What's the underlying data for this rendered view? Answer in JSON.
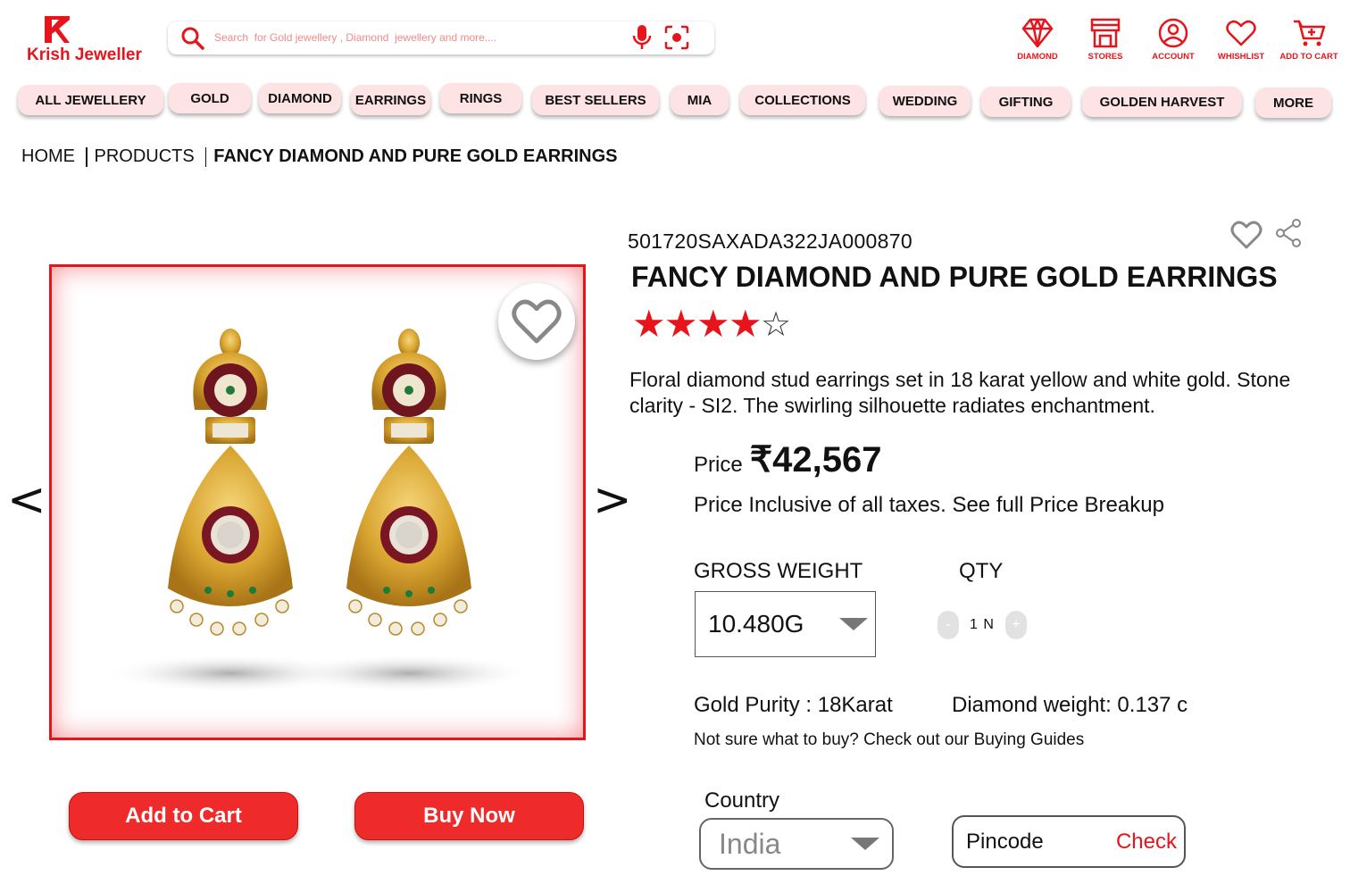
{
  "brand": {
    "name": "Krish Jeweller",
    "accent": "#e8141b"
  },
  "search": {
    "placeholder": "Search  for Gold jewellery , Diamond  jewellery and more...."
  },
  "header_icons": [
    {
      "icon": "diamond-icon",
      "label": "DIAMOND"
    },
    {
      "icon": "store-icon",
      "label": "STORES"
    },
    {
      "icon": "account-icon",
      "label": "ACCOUNT"
    },
    {
      "icon": "heart-icon",
      "label": "WHISHLIST"
    },
    {
      "icon": "cart-add-icon",
      "label": "ADD TO CART"
    }
  ],
  "nav": [
    "ALL JEWELLERY",
    "GOLD",
    "DIAMOND",
    "EARRINGS",
    "RINGS",
    "BEST SELLERS",
    "MIA",
    "COLLECTIONS",
    "WEDDING",
    "GIFTING",
    "GOLDEN HARVEST",
    "MORE"
  ],
  "breadcrumb": [
    "HOME",
    "PRODUCTS",
    "FANCY DIAMOND AND PURE GOLD EARRINGS"
  ],
  "gallery": {
    "prev": "<",
    "next": ">"
  },
  "actions": {
    "add_to_cart": "Add to Cart",
    "buy_now": "Buy Now"
  },
  "product": {
    "sku": "501720SAXADA322JA000870",
    "title": "FANCY DIAMOND AND PURE GOLD EARRINGS",
    "rating": {
      "value": 4,
      "max": 5
    },
    "description": "Floral diamond stud earrings set in 18 karat yellow and white gold. Stone clarity - SI2. The swirling silhouette radiates enchantment.",
    "price_label": "Price",
    "price": "₹42,567",
    "price_note": "Price Inclusive of all taxes. See full Price Breakup",
    "gross_weight_label": "GROSS WEIGHT",
    "gross_weight": "10.480G",
    "qty_label": "QTY",
    "qty_minus": "-",
    "qty_value": "1 N",
    "qty_plus": "+",
    "gold_purity": "Gold Purity : 18Karat",
    "diamond_weight": "Diamond weight: 0.137 c",
    "buying_guides": "Not sure what to buy? Check out our Buying Guides"
  },
  "delivery": {
    "country_label": "Country",
    "country": "India",
    "pincode_placeholder": "Pincode",
    "check": "Check"
  }
}
